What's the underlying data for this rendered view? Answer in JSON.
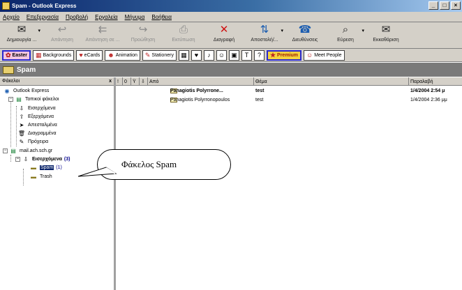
{
  "window": {
    "title": "Spam - Outlook Express"
  },
  "menu": [
    "Αρχείο",
    "Επεξεργασία",
    "Προβολή",
    "Εργαλεία",
    "Μήνυμα",
    "Βοήθεια"
  ],
  "toolbar": [
    {
      "label": "Δημιουργία ...",
      "icon": "new-mail-icon",
      "glyph": "✉",
      "disabled": false,
      "dropdown": true
    },
    {
      "label": "Απάντηση",
      "icon": "reply-icon",
      "glyph": "↩",
      "disabled": true,
      "dropdown": false
    },
    {
      "label": "Απάντηση σε ...",
      "icon": "reply-all-icon",
      "glyph": "⇇",
      "disabled": true,
      "dropdown": false
    },
    {
      "label": "Προώθηση",
      "icon": "forward-icon",
      "glyph": "↪",
      "disabled": true,
      "dropdown": false
    },
    {
      "label": "Εκτύπωση",
      "icon": "print-icon",
      "glyph": "⎙",
      "disabled": true,
      "dropdown": false
    },
    {
      "label": "Διαγραφή",
      "icon": "delete-icon",
      "glyph": "✕",
      "disabled": false,
      "dropdown": false
    },
    {
      "label": "Αποστολή/...",
      "icon": "send-receive-icon",
      "glyph": "⇅",
      "disabled": false,
      "dropdown": true
    },
    {
      "label": "Διευθύνσεις",
      "icon": "address-book-icon",
      "glyph": "☎",
      "disabled": false,
      "dropdown": false
    },
    {
      "label": "Εύρεση",
      "icon": "find-icon",
      "glyph": "⌕",
      "disabled": false,
      "dropdown": true
    },
    {
      "label": "Εκκαθάριση",
      "icon": "purge-icon",
      "glyph": "✉",
      "disabled": false,
      "dropdown": false
    }
  ],
  "incredibar": {
    "easter": "Easter",
    "backgrounds": "Backgrounds",
    "ecards": "eCards",
    "animation": "Animation",
    "stationery": "Stationery",
    "help": "?",
    "premium": "Premium",
    "meet_people": "Meet People"
  },
  "folder_bar": {
    "title": "Spam"
  },
  "folder_pane": {
    "header": "Φάκελοι",
    "close": "x",
    "root": "Outlook Express",
    "local": "Τοπικοί φάκελοι",
    "local_items": [
      "Εισερχόμενα",
      "Εξερχόμενα",
      "Απεσταλμένα",
      "Διαγραμμένα",
      "Πρόχειρα"
    ],
    "account": "mail.ach.sch.gr",
    "inbox": "Εισερχόμενα",
    "inbox_count": "(3)",
    "spam": "Spam",
    "spam_count": "(1)",
    "trash": "Trash"
  },
  "message_list": {
    "columns": {
      "priority": "!",
      "attach": "0",
      "flag": "Ϋ",
      "status": "⇩",
      "from": "Από",
      "subject": "Θέμα",
      "received": "Παραλαβή"
    },
    "rows": [
      {
        "from": "Panagiotis Polyrrone...",
        "subject": "test",
        "received": "1/4/2004 2:54 μ",
        "unread": true
      },
      {
        "from": "Panagiotis Polyrronopoulos",
        "subject": "test",
        "received": "1/4/2004 2:36 μμ",
        "unread": false
      }
    ]
  },
  "callout": {
    "text": "Φάκελος Spam"
  }
}
